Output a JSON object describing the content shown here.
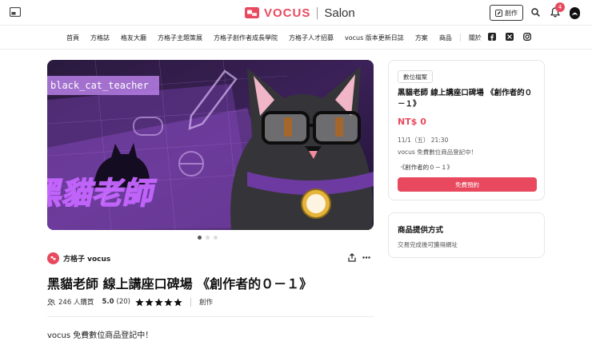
{
  "header": {
    "brand": "VOCUS",
    "brand_sub": "Salon",
    "create_label": "創作",
    "notification_count": "4",
    "brand_color": "#e8495e"
  },
  "nav": {
    "items": [
      "首頁",
      "方格誌",
      "格友大廳",
      "方格子主題策展",
      "方格子創作者成長學院",
      "方格子人才招募",
      "vocus 版本更新日誌",
      "方案",
      "商品",
      "關於"
    ],
    "social": [
      "facebook-icon",
      "x-icon",
      "instagram-icon"
    ]
  },
  "banner": {
    "text": "black_cat_teacher",
    "slide_count": 3,
    "active_slide": 0
  },
  "author": {
    "name": "方格子 vocus"
  },
  "product": {
    "title": "黑貓老師 線上講座口碑場 《創作者的０－１》",
    "buyers": "246 人購買",
    "rating": "5.0",
    "rating_count": "(20)",
    "stars": 5,
    "category": "創作",
    "description": "vocus 免費數位商品登記中！"
  },
  "card": {
    "tag": "數位檔案",
    "title": "黑貓老師 線上講座口碑場 《創作者的０－１》",
    "price": "NT$ 0",
    "date": "11/1（五） 21:30",
    "note": "vocus 免費數位商品登記中！",
    "bullet": "‧《創作者的０－１》",
    "button": "免費預約"
  },
  "delivery": {
    "title": "商品提供方式",
    "text": "交易完成後可獲得網址"
  }
}
